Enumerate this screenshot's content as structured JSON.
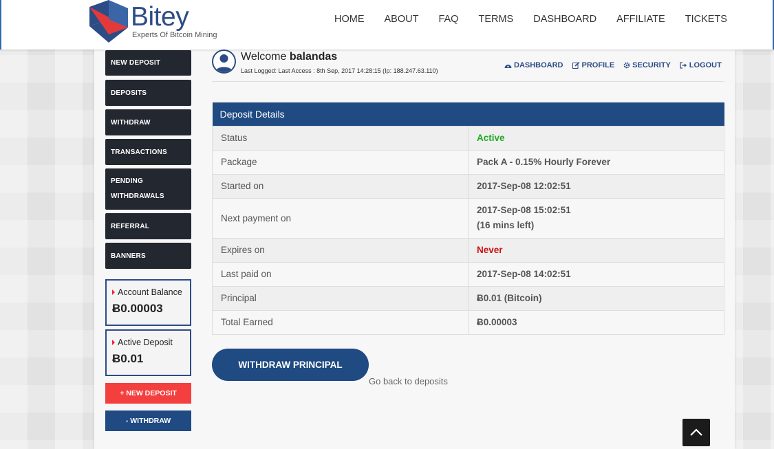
{
  "brand": {
    "name": "Bitey",
    "tagline": "Experts Of Bitcoin Mining",
    "colors": {
      "navy": "#2c4c86",
      "red": "#e23a3a",
      "dark": "#23272f"
    }
  },
  "nav": [
    "HOME",
    "ABOUT",
    "FAQ",
    "TERMS",
    "DASHBOARD",
    "AFFILIATE",
    "TICKETS"
  ],
  "sidebar": {
    "items": [
      {
        "label": "NEW DEPOSIT"
      },
      {
        "label": "DEPOSITS"
      },
      {
        "label": "WITHDRAW"
      },
      {
        "label": "TRANSACTIONS"
      },
      {
        "label_line1": "PENDING",
        "label_line2": "WITHDRAWALS"
      },
      {
        "label": "REFERRAL"
      },
      {
        "label": "BANNERS"
      }
    ],
    "account_balance": {
      "label": "Account Balance",
      "value": "Ƀ0.00003"
    },
    "active_deposit": {
      "label": "Active Deposit",
      "value": "Ƀ0.01"
    },
    "new_deposit_button": "+ NEW DEPOSIT",
    "withdraw_button": "- WITHDRAW",
    "button_colors": {
      "new_deposit": "#f43f3f",
      "withdraw": "#1f4a82"
    }
  },
  "welcome": {
    "greeting": "Welcome",
    "username": "balandas",
    "last_logged": "Last Logged: Last Access : 8th Sep, 2017 14:28:15 (Ip: 188.247.63.110)"
  },
  "user_links": [
    {
      "icon": "dashboard-icon",
      "label": "DASHBOARD"
    },
    {
      "icon": "edit-icon",
      "label": "PROFILE"
    },
    {
      "icon": "gear-icon",
      "label": "SECURITY"
    },
    {
      "icon": "logout-icon",
      "label": "LOGOUT"
    }
  ],
  "deposit_details": {
    "title": "Deposit Details",
    "rows": [
      {
        "label": "Status",
        "value": "Active",
        "color": "#22aa22"
      },
      {
        "label": "Package",
        "value": "Pack A - 0.15% Hourly Forever"
      },
      {
        "label": "Started on",
        "value": "2017-Sep-08 12:02:51"
      },
      {
        "label": "Next payment on",
        "value": "2017-Sep-08 15:02:51",
        "value2": "(16 mins left)"
      },
      {
        "label": "Expires on",
        "value": "Never",
        "color": "#cc1111"
      },
      {
        "label": "Last paid on",
        "value": "2017-Sep-08 14:02:51"
      },
      {
        "label": "Principal",
        "value": "Ƀ0.01 (Bitcoin)"
      },
      {
        "label": "Total Earned",
        "value": "Ƀ0.00003"
      }
    ]
  },
  "actions": {
    "withdraw_principal": "WITHDRAW PRINCIPAL",
    "go_back": "Go back to deposits"
  }
}
